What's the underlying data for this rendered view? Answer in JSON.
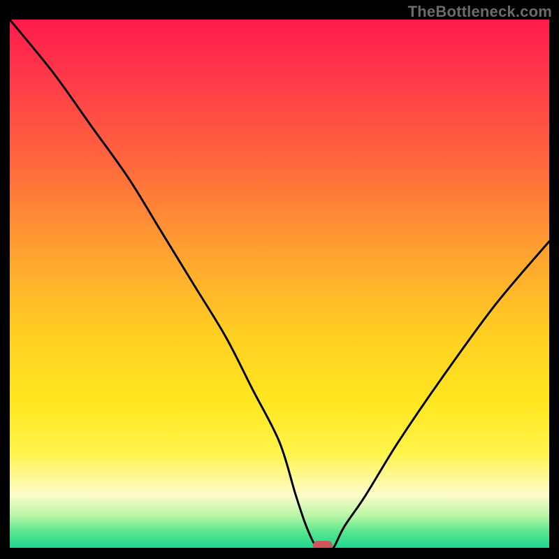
{
  "attribution": "TheBottleneck.com",
  "chart_data": {
    "type": "line",
    "title": "",
    "xlabel": "",
    "ylabel": "",
    "xlim": [
      0,
      100
    ],
    "ylim": [
      0,
      100
    ],
    "series": [
      {
        "name": "bottleneck-curve",
        "x": [
          0,
          8,
          15,
          22,
          28,
          34,
          40,
          45,
          50,
          53,
          55,
          57,
          59,
          60,
          62,
          66,
          72,
          80,
          90,
          100
        ],
        "values": [
          100,
          90,
          80,
          70,
          60,
          50,
          40,
          30,
          20,
          10,
          4,
          0,
          0,
          0,
          4,
          10,
          20,
          32,
          46,
          58
        ]
      }
    ],
    "marker": {
      "name": "optimal-marker",
      "x": 58,
      "y": 0,
      "color": "#d0555c"
    },
    "background_gradient_stops": [
      {
        "pos": 0,
        "color": "#ff1b4b"
      },
      {
        "pos": 12,
        "color": "#ff3c49"
      },
      {
        "pos": 28,
        "color": "#ff6a3c"
      },
      {
        "pos": 45,
        "color": "#ffa52f"
      },
      {
        "pos": 60,
        "color": "#ffd022"
      },
      {
        "pos": 72,
        "color": "#ffe61f"
      },
      {
        "pos": 82,
        "color": "#fff44a"
      },
      {
        "pos": 90,
        "color": "#fdfccb"
      },
      {
        "pos": 94,
        "color": "#b7f6a6"
      },
      {
        "pos": 97,
        "color": "#57e68e"
      },
      {
        "pos": 100,
        "color": "#1ed891"
      }
    ]
  }
}
